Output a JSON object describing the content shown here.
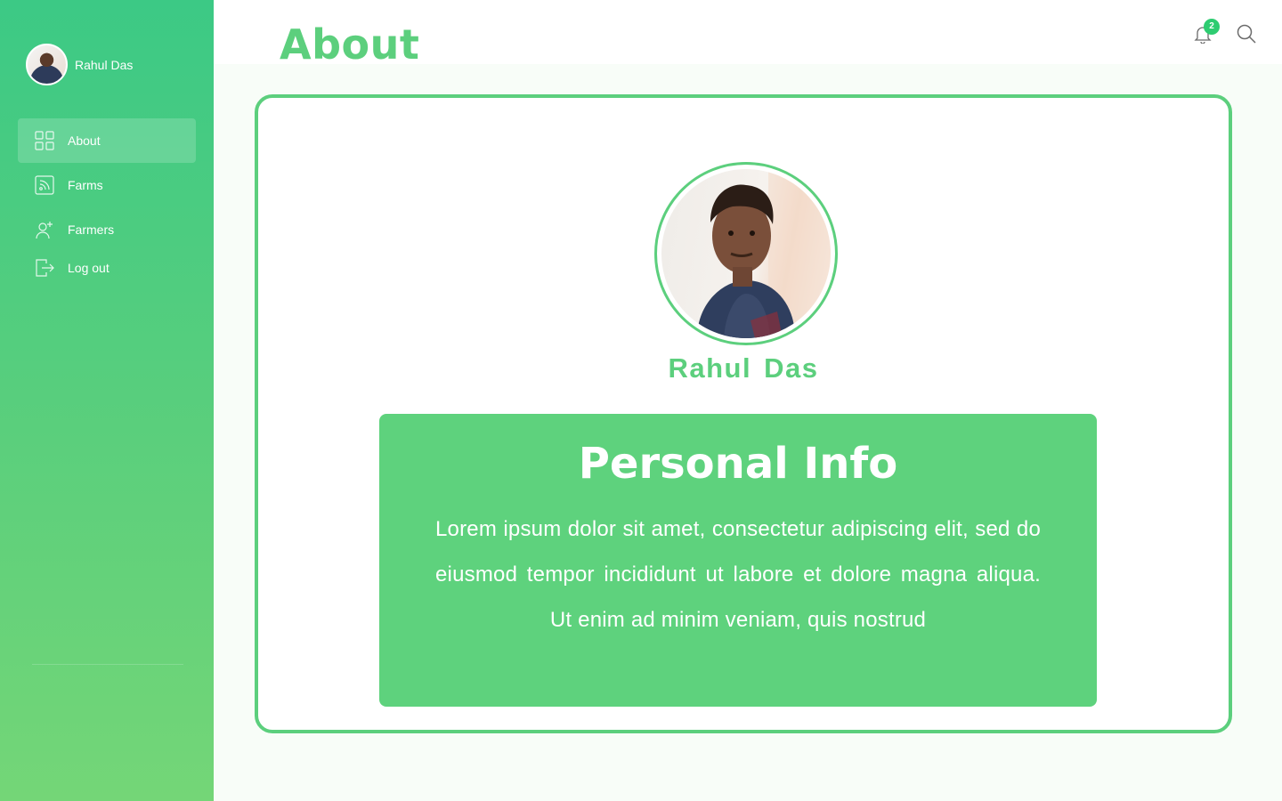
{
  "sidebar": {
    "user": {
      "name": "Rahul Das"
    },
    "items": [
      {
        "label": "About",
        "icon": "grid-icon",
        "active": true
      },
      {
        "label": "Farms",
        "icon": "rss-icon",
        "active": false
      },
      {
        "label": "Farmers",
        "icon": "add-user-icon",
        "active": false
      },
      {
        "label": "Log out",
        "icon": "logout-icon",
        "active": false
      }
    ]
  },
  "header": {
    "title": "About",
    "notifications": {
      "icon": "bell-icon",
      "count": "2"
    },
    "search": {
      "icon": "search-icon"
    }
  },
  "profile": {
    "name": "Rahul Das",
    "info_title": "Personal Info",
    "info_text": "Lorem ipsum dolor sit amet, consectetur adipiscing elit, sed do eiusmod tempor incididunt ut labore et dolore magna aliqua. Ut enim ad minim veniam, quis nostrud"
  },
  "colors": {
    "accent": "#5ccf7d",
    "sidebar_top": "#3cc985",
    "sidebar_bottom": "#74d677",
    "badge": "#2ecc71"
  }
}
